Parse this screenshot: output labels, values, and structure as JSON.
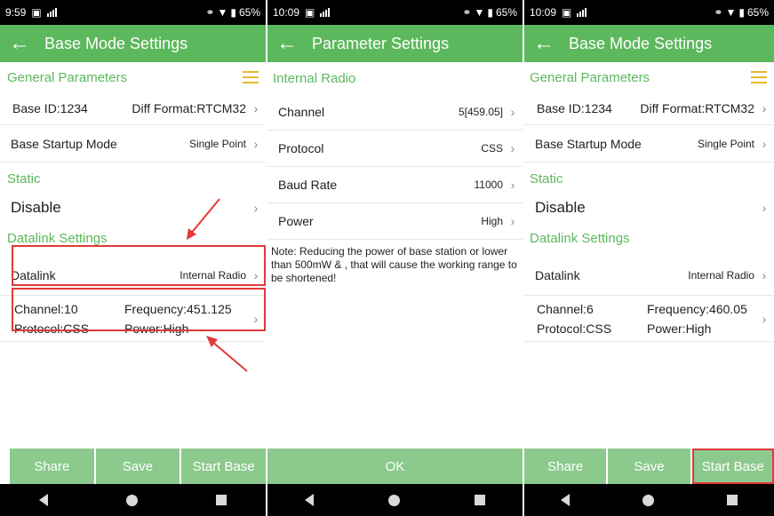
{
  "screen1": {
    "status": {
      "time": "9:59",
      "battery": "65%"
    },
    "title": "Base Mode Settings",
    "general_header": "General Parameters",
    "base_id": "Base ID:1234",
    "diff_format": "Diff Format:RTCM32",
    "startup_label": "Base Startup Mode",
    "startup_value": "Single Point",
    "static_header": "Static",
    "static_value": "Disable",
    "datalink_header": "Datalink Settings",
    "datalink_label": "Datalink",
    "datalink_value": "Internal Radio",
    "channel": "Channel:10",
    "frequency": "Frequency:451.125",
    "protocol": "Protocol:CSS",
    "power": "Power:High",
    "buttons": {
      "share": "Share",
      "save": "Save",
      "start": "Start Base"
    }
  },
  "screen2": {
    "status": {
      "time": "10:09",
      "battery": "65%"
    },
    "title": "Parameter Settings",
    "section": "Internal Radio",
    "rows": [
      {
        "label": "Channel",
        "value": "5[459.05]"
      },
      {
        "label": "Protocol",
        "value": "CSS"
      },
      {
        "label": "Baud Rate",
        "value": "11000"
      },
      {
        "label": "Power",
        "value": "High"
      }
    ],
    "note": "Note: Reducing the power of base station or lower than 500mW & , that will cause the working range to be shortened!",
    "ok": "OK"
  },
  "screen3": {
    "status": {
      "time": "10:09",
      "battery": "65%"
    },
    "title": "Base Mode Settings",
    "general_header": "General Parameters",
    "base_id": "Base ID:1234",
    "diff_format": "Diff Format:RTCM32",
    "startup_label": "Base Startup Mode",
    "startup_value": "Single Point",
    "static_header": "Static",
    "static_value": "Disable",
    "datalink_header": "Datalink Settings",
    "datalink_label": "Datalink",
    "datalink_value": "Internal Radio",
    "channel": "Channel:6",
    "frequency": "Frequency:460.05",
    "protocol": "Protocol:CSS",
    "power": "Power:High",
    "buttons": {
      "share": "Share",
      "save": "Save",
      "start": "Start Base"
    }
  },
  "colors": {
    "accent": "#5cb85c",
    "button": "#8cc98c",
    "highlight": "#e03a3a"
  }
}
